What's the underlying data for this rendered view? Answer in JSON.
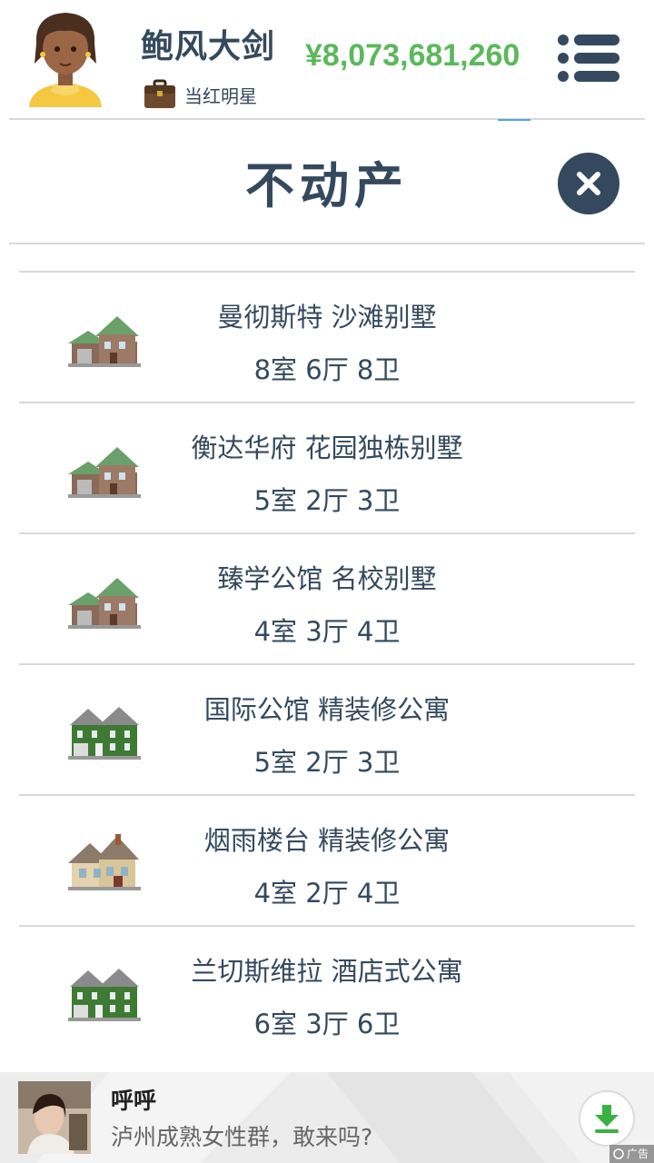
{
  "header": {
    "player_name": "鲍风大剑",
    "job_title": "当红明星",
    "money": "¥8,073,681,260"
  },
  "panel": {
    "title": "不动产"
  },
  "properties": [
    {
      "name": "曼彻斯特 沙滩别墅",
      "rooms": "8室 6厅 8卫",
      "icon": "villa-icon"
    },
    {
      "name": "衡达华府 花园独栋别墅",
      "rooms": "5室 2厅 3卫",
      "icon": "villa-icon"
    },
    {
      "name": "臻学公馆 名校别墅",
      "rooms": "4室 3厅 4卫",
      "icon": "villa-icon"
    },
    {
      "name": "国际公馆 精装修公寓",
      "rooms": "5室 2厅 3卫",
      "icon": "green-house-icon"
    },
    {
      "name": "烟雨楼台 精装修公寓",
      "rooms": "4室 2厅 4卫",
      "icon": "beige-house-icon"
    },
    {
      "name": "兰切斯维拉 酒店式公寓",
      "rooms": "6室 3厅 6卫",
      "icon": "green-house-icon"
    }
  ],
  "ad": {
    "title": "呼呼",
    "text": "泸州成熟女性群，敢来吗?",
    "badge": "广告"
  },
  "colors": {
    "text_primary": "#34495e",
    "money_green": "#5cb85c",
    "divider": "#d6d9dc",
    "close_button": "#34495e",
    "download_green": "#3cb043"
  }
}
